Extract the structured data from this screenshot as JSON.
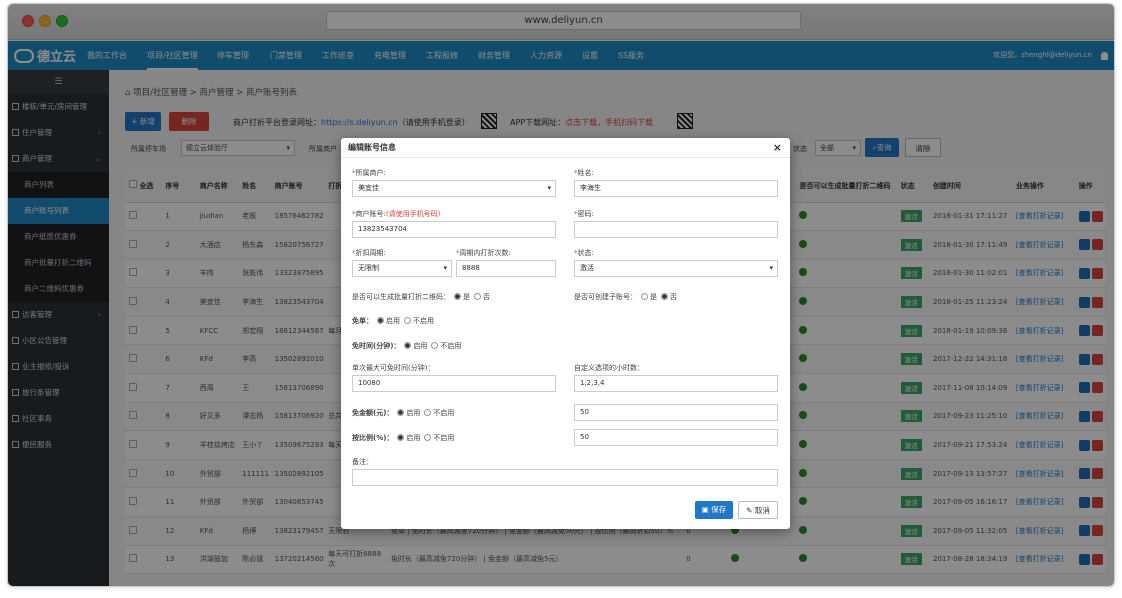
{
  "browser": {
    "url": "www.deliyun.cn"
  },
  "brand": {
    "name": "德立云"
  },
  "topnav": {
    "items": [
      "我的工作台",
      "项目/社区管理",
      "停车管理",
      "门禁管理",
      "工作巡查",
      "充电管理",
      "工程报修",
      "财务管理",
      "人力资源",
      "设置",
      "SS服务"
    ],
    "welcome": "欢迎您，zhenghl@deliyun.cn"
  },
  "sidebar": {
    "toggle": "☰",
    "items": [
      {
        "label": "楼栋/单元/房间管理",
        "sub": false
      },
      {
        "label": "住户管理",
        "sub": false,
        "caret": "›"
      },
      {
        "label": "商户管理",
        "sub": false,
        "caret": "⌄"
      },
      {
        "label": "商户列表",
        "sub": true
      },
      {
        "label": "商户账号列表",
        "sub": true,
        "active": true
      },
      {
        "label": "商户纸质优惠券",
        "sub": true
      },
      {
        "label": "商户批量打折二维码",
        "sub": true
      },
      {
        "label": "商户二维码优惠券",
        "sub": true
      },
      {
        "label": "访客管理",
        "sub": false,
        "caret": "›"
      },
      {
        "label": "小区公告管理",
        "sub": false
      },
      {
        "label": "业主报修/投诉",
        "sub": false
      },
      {
        "label": "放行条管理",
        "sub": false
      },
      {
        "label": "社区事务",
        "sub": false
      },
      {
        "label": "便民服务",
        "sub": false
      }
    ]
  },
  "breadcrumb": "项目/社区管理  >  商户管理  >  商户账号列表",
  "toolbar": {
    "add": "+ 新增",
    "delete": "删除",
    "platform_label": "商户打折平台登录网址：",
    "platform_url": "https://s.deliyun.cn",
    "platform_note": "（请使用手机登录）",
    "app_label": "APP下载网址：",
    "app_link": "点击下载，手机扫码下载"
  },
  "filter": {
    "parking_label": "所属停车场",
    "parking_value": "德立云体验厅",
    "merchant_label": "所属商户",
    "status_label": "状态",
    "status_value": "全部",
    "search": "查询",
    "clear": "清除"
  },
  "table": {
    "headers": [
      "全选",
      "序号",
      "商户名称",
      "姓名",
      "商户账号",
      "打折",
      "",
      "",
      "",
      "",
      "是否可以生成批量打折二维码",
      "状态",
      "创建时间",
      "业务操作",
      "操作"
    ],
    "rows": [
      {
        "no": "1",
        "merchant": "jiudian",
        "name": "老板",
        "account": "18576462782",
        "tail": "",
        "created": "2018-01-31 17:11:27"
      },
      {
        "no": "2",
        "merchant": "大酒店",
        "name": "杨东森",
        "account": "15820756727",
        "tail": "",
        "created": "2018-01-30 17:11:49"
      },
      {
        "no": "3",
        "merchant": "羊肉",
        "name": "张乾伟",
        "account": "13323875895",
        "tail": "",
        "created": "2018-01-30 11:02:01"
      },
      {
        "no": "4",
        "merchant": "美宜佳",
        "name": "李海生",
        "account": "13823543704",
        "tail": "",
        "created": "2018-01-25 11:23:24"
      },
      {
        "no": "5",
        "merchant": "KFCC",
        "name": "郑宏翔",
        "account": "18612344567",
        "tail": "每月",
        "created": "2018-01-19 10:09:36"
      },
      {
        "no": "6",
        "merchant": "KFd",
        "name": "李高",
        "account": "13502892010",
        "tail": "",
        "created": "2017-12-22 14:31:18"
      },
      {
        "no": "7",
        "merchant": "西周",
        "name": "王",
        "account": "15813706890",
        "tail": "",
        "created": "2017-11-08 10:14:09"
      },
      {
        "no": "8",
        "merchant": "好又多",
        "name": "谭志杨",
        "account": "15813706920",
        "tail": "总共",
        "created": "2017-09-23 11:25:10"
      },
      {
        "no": "9",
        "merchant": "羊桂烧烤店",
        "name": "王小丫",
        "account": "13509675293",
        "tail": "每天",
        "created": "2017-09-21 17:53:24"
      },
      {
        "no": "10",
        "merchant": "外贸部",
        "name": "111111",
        "account": "13502892105",
        "tail": "",
        "created": "2017-09-13 13:57:27"
      },
      {
        "no": "11",
        "merchant": "外贸部",
        "name": "外贸部",
        "account": "13040853745",
        "tail": "",
        "created": "2017-09-05 16:16:17"
      },
      {
        "no": "12",
        "merchant": "KFd",
        "name": "杨博",
        "account": "13823179457",
        "tail": "无限制",
        "desc": "免单 | 免时长（最高减免720分钟） | 免金额（最高减免50元） | 按比例（最高折扣50）%",
        "created": "2017-09-05 11:32:05"
      },
      {
        "no": "13",
        "merchant": "洪湖鼓加",
        "name": "陈必斌",
        "account": "13720214560",
        "tail": "每天可打折8888次",
        "desc": "免时长（最高减免720分钟） | 免金额（最高减免5元）",
        "created": "2017-08-28 18:34:19"
      }
    ],
    "status_badge": "激活",
    "op_link": "[查看打折记录]",
    "zero": "0"
  },
  "modal": {
    "title": "编辑账号信息",
    "merchant_label": "所属商户:",
    "merchant_value": "美宜佳",
    "name_label": "姓名:",
    "name_value": "李海生",
    "account_label": "商户账号:",
    "account_hint": "(请使用手机号码)",
    "account_value": "13823543704",
    "password_label": "密码:",
    "password_value": "",
    "cycle_label": "折扣周期:",
    "cycle_value": "无限制",
    "count_label": "周期内打折次数:",
    "count_value": "8888",
    "status_label": "状态:",
    "status_value": "激活",
    "batch_label": "是否可以生成批量打折二维码：",
    "child_label": "是否可创建子账号：",
    "yes": "是",
    "no": "否",
    "free_label": "免单：",
    "enable": "启用",
    "disable": "不启用",
    "freetime_label": "免时间(分钟)：",
    "max_label": "单次最大可免时间(分钟)：",
    "max_value": "10080",
    "custom_label": "自定义选项的小时数：",
    "custom_value": "1,2,3,4",
    "amount_label": "免金额(元)：",
    "amount_value": "50",
    "ratio_label": "按比例(%)：",
    "ratio_value": "50",
    "remark_label": "备注：",
    "remark_value": "",
    "save": "保存",
    "cancel": "取消",
    "close": "×"
  }
}
